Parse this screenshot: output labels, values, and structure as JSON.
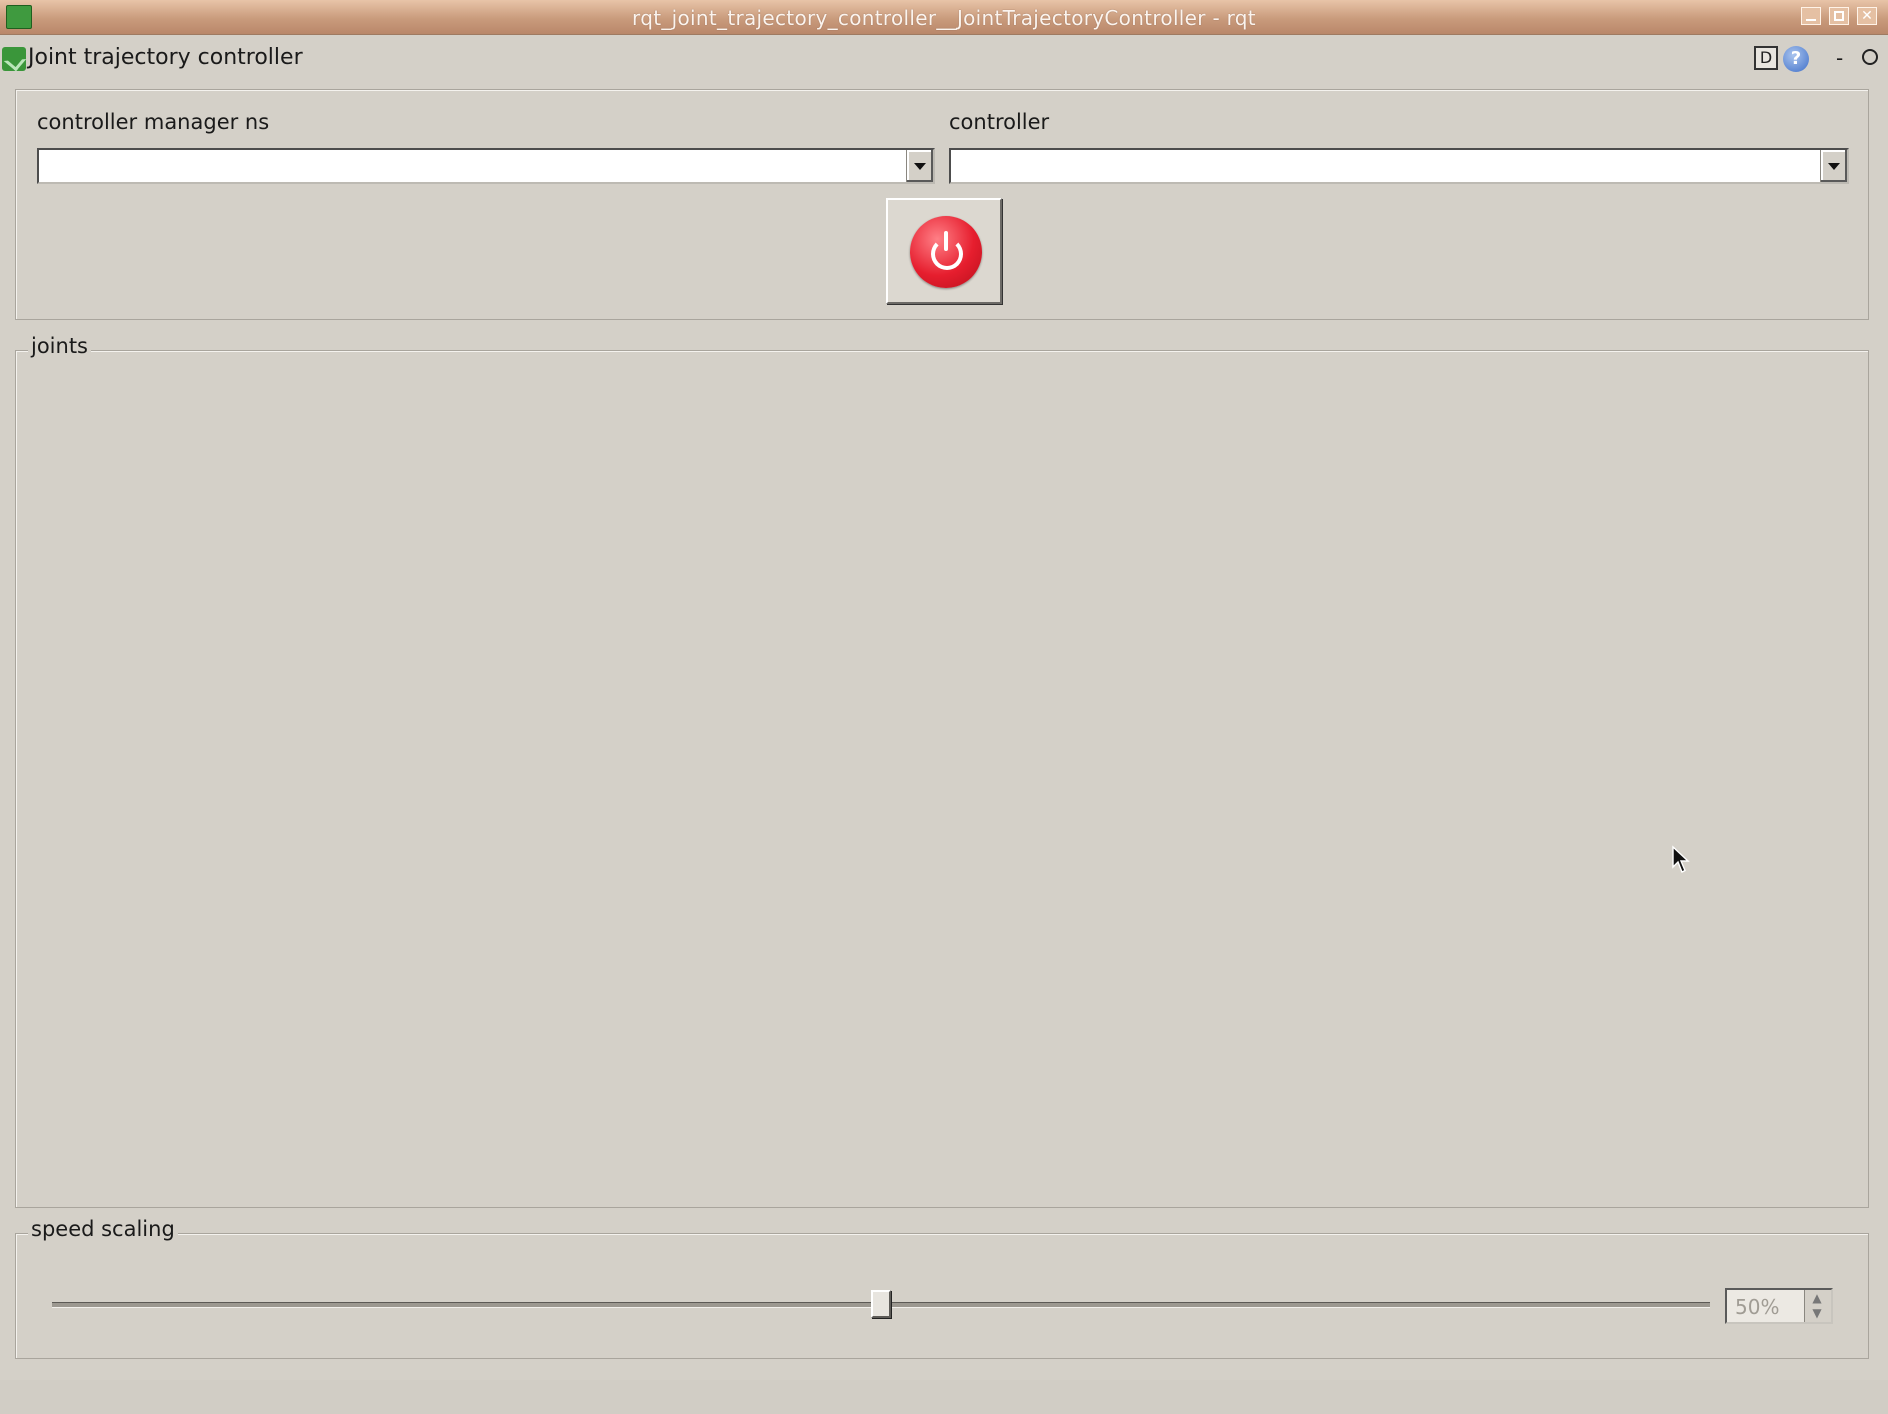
{
  "window": {
    "title": "rqt_joint_trajectory_controller__JointTrajectoryController - rqt"
  },
  "plugin": {
    "title": "Joint trajectory controller",
    "dock_label": "D",
    "help_label": "?",
    "minimize_label": "-"
  },
  "controller_manager_ns": {
    "label": "controller manager ns",
    "value": ""
  },
  "controller": {
    "label": "controller",
    "value": ""
  },
  "power_button": {
    "state": "off",
    "color": "#e61e2e"
  },
  "joints": {
    "title": "joints",
    "items": []
  },
  "speed_scaling": {
    "title": "speed scaling",
    "value_percent": 50,
    "display": "50%"
  }
}
